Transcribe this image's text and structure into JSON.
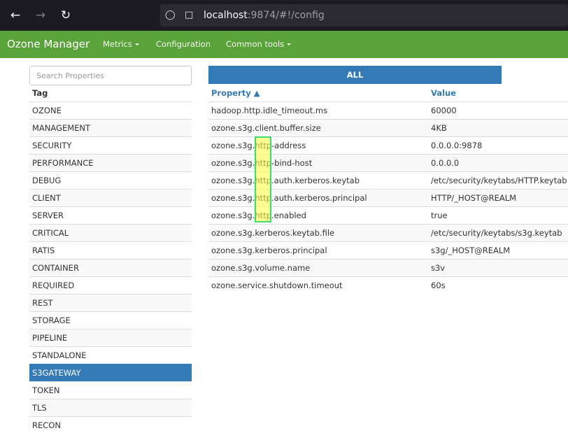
{
  "browser": {
    "url_host": "localhost",
    "url_rest": ":9874/#!/config"
  },
  "navbar": {
    "brand": "Ozone Manager",
    "items": [
      {
        "label": "Metrics",
        "dropdown": true
      },
      {
        "label": "Configuration",
        "dropdown": false
      },
      {
        "label": "Common tools",
        "dropdown": true
      }
    ]
  },
  "sidebar": {
    "search_placeholder": "Search Properties",
    "tag_header": "Tag",
    "tags": [
      "OZONE",
      "MANAGEMENT",
      "SECURITY",
      "PERFORMANCE",
      "DEBUG",
      "CLIENT",
      "SERVER",
      "CRITICAL",
      "RATIS",
      "CONTAINER",
      "REQUIRED",
      "REST",
      "STORAGE",
      "PIPELINE",
      "STANDALONE",
      "S3GATEWAY",
      "TOKEN",
      "TLS",
      "RECON"
    ],
    "active_tag": "S3GATEWAY"
  },
  "main": {
    "all_button": "ALL",
    "col_property": "Property ▲",
    "col_value": "Value",
    "rows": [
      {
        "property": "hadoop.http.idle_timeout.ms",
        "value": "60000"
      },
      {
        "property": "ozone.s3g.client.buffer.size",
        "value": "4KB"
      },
      {
        "property": "ozone.s3g.http-address",
        "value": "0.0.0.0:9878"
      },
      {
        "property": "ozone.s3g.http-bind-host",
        "value": "0.0.0.0"
      },
      {
        "property": "ozone.s3g.http.auth.kerberos.keytab",
        "value": "/etc/security/keytabs/HTTP.keytab"
      },
      {
        "property": "ozone.s3g.http.auth.kerberos.principal",
        "value": "HTTP/_HOST@REALM"
      },
      {
        "property": "ozone.s3g.http.enabled",
        "value": "true"
      },
      {
        "property": "ozone.s3g.kerberos.keytab.file",
        "value": "/etc/security/keytabs/s3g.keytab"
      },
      {
        "property": "ozone.s3g.kerberos.principal",
        "value": "s3g/_HOST@REALM"
      },
      {
        "property": "ozone.s3g.volume.name",
        "value": "s3v"
      },
      {
        "property": "ozone.service.shutdown.timeout",
        "value": "60s"
      }
    ]
  }
}
